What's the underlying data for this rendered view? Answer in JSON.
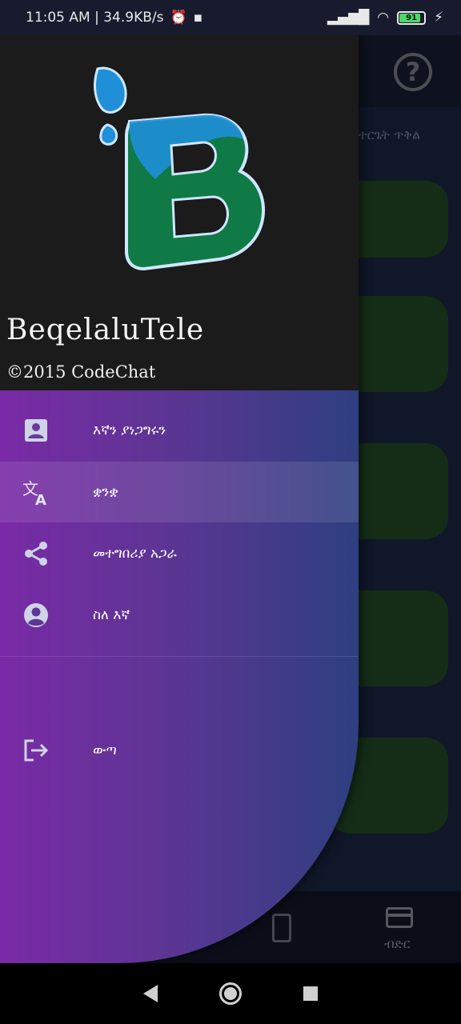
{
  "status_bar": {
    "time_speed": "11:05 AM | 34.9KB/s",
    "battery": "91"
  },
  "background_app": {
    "subtitle": "ተርጌት ጥቅል",
    "bottom_nav_card_label": "ብድር"
  },
  "drawer": {
    "app_name": "BeqelaluTele",
    "copyright": "©2015 CodeChat",
    "items": [
      {
        "label": "እኛን ያነጋግሩን",
        "icon": "contact-icon"
      },
      {
        "label": "ቋንቋ",
        "icon": "translate-icon"
      },
      {
        "label": "መተግበሪያ አጋራ",
        "icon": "share-icon"
      },
      {
        "label": "ስለ እኛ",
        "icon": "account-circle-icon"
      },
      {
        "label": "ውጣ",
        "icon": "logout-icon"
      }
    ],
    "selected_index": 1
  },
  "colors": {
    "drawer_gradient_start": "#7a2aa6",
    "drawer_gradient_end": "#2e3f80",
    "header_bg": "#1b1b1b",
    "logo_green": "#0f7a45",
    "logo_blue": "#1f8fd8"
  }
}
